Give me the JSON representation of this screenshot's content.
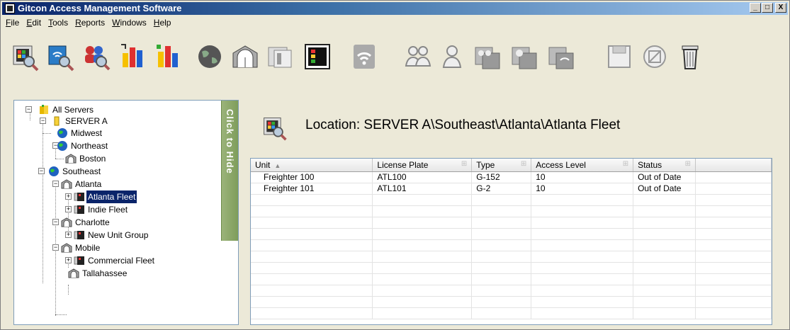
{
  "window": {
    "title": "Gitcon Access Management Software",
    "minimize": "_",
    "maximize": "□",
    "close": "X"
  },
  "menu": [
    {
      "label": "File",
      "u": "F",
      "rest": "ile"
    },
    {
      "label": "Edit",
      "u": "E",
      "rest": "dit"
    },
    {
      "label": "Tools",
      "u": "T",
      "rest": "ools"
    },
    {
      "label": "Reports",
      "u": "R",
      "rest": "eports"
    },
    {
      "label": "Windows",
      "u": "W",
      "rest": "indows"
    },
    {
      "label": "Help",
      "u": "H",
      "rest": "elp"
    }
  ],
  "toolbar": [
    {
      "name": "find-unit-button-icon"
    },
    {
      "name": "find-wireless-unit-button-icon"
    },
    {
      "name": "find-users-button-icon"
    },
    {
      "name": "unit-report-button-icon"
    },
    {
      "name": "access-report-button-icon"
    },
    {
      "name": "add-region-button-icon"
    },
    {
      "name": "add-location-button-icon"
    },
    {
      "name": "add-unit-group-button-icon"
    },
    {
      "name": "add-unit-button-icon"
    },
    {
      "name": "wireless-button-icon"
    },
    {
      "name": "add-user-group-button-icon"
    },
    {
      "name": "add-user-button-icon"
    },
    {
      "name": "user-group-access-button-icon"
    },
    {
      "name": "user-access-button-icon"
    },
    {
      "name": "wireless-access-button-icon"
    },
    {
      "name": "save-button-icon"
    },
    {
      "name": "cancel-button-icon"
    },
    {
      "name": "delete-button-icon"
    }
  ],
  "tree": {
    "hide_tab": "Click to Hide",
    "nodes": {
      "all_servers": "All Servers",
      "server_a": "SERVER A",
      "midwest": "Midwest",
      "northeast": "Northeast",
      "boston": "Boston",
      "southeast": "Southeast",
      "atlanta": "Atlanta",
      "atlanta_fleet": "Atlanta Fleet",
      "indie_fleet": "Indie Fleet",
      "charlotte": "Charlotte",
      "new_unit_group": "New Unit Group",
      "mobile": "Mobile",
      "commercial_fleet": "Commercial Fleet",
      "tallahassee": "Tallahassee"
    }
  },
  "location": {
    "text": "Location: SERVER A\\Southeast\\Atlanta\\Atlanta Fleet"
  },
  "grid": {
    "columns": [
      "Unit",
      "License Plate",
      "Type",
      "Access Level",
      "Status"
    ],
    "sort_indicator": "▲",
    "filter_glyph": "⊞",
    "rows": [
      [
        "Freighter 100",
        "ATL100",
        "G-152",
        "10",
        "Out of Date"
      ],
      [
        "Freighter 101",
        "ATL101",
        "G-2",
        "10",
        "Out of Date"
      ]
    ],
    "empty_rows": 11
  }
}
